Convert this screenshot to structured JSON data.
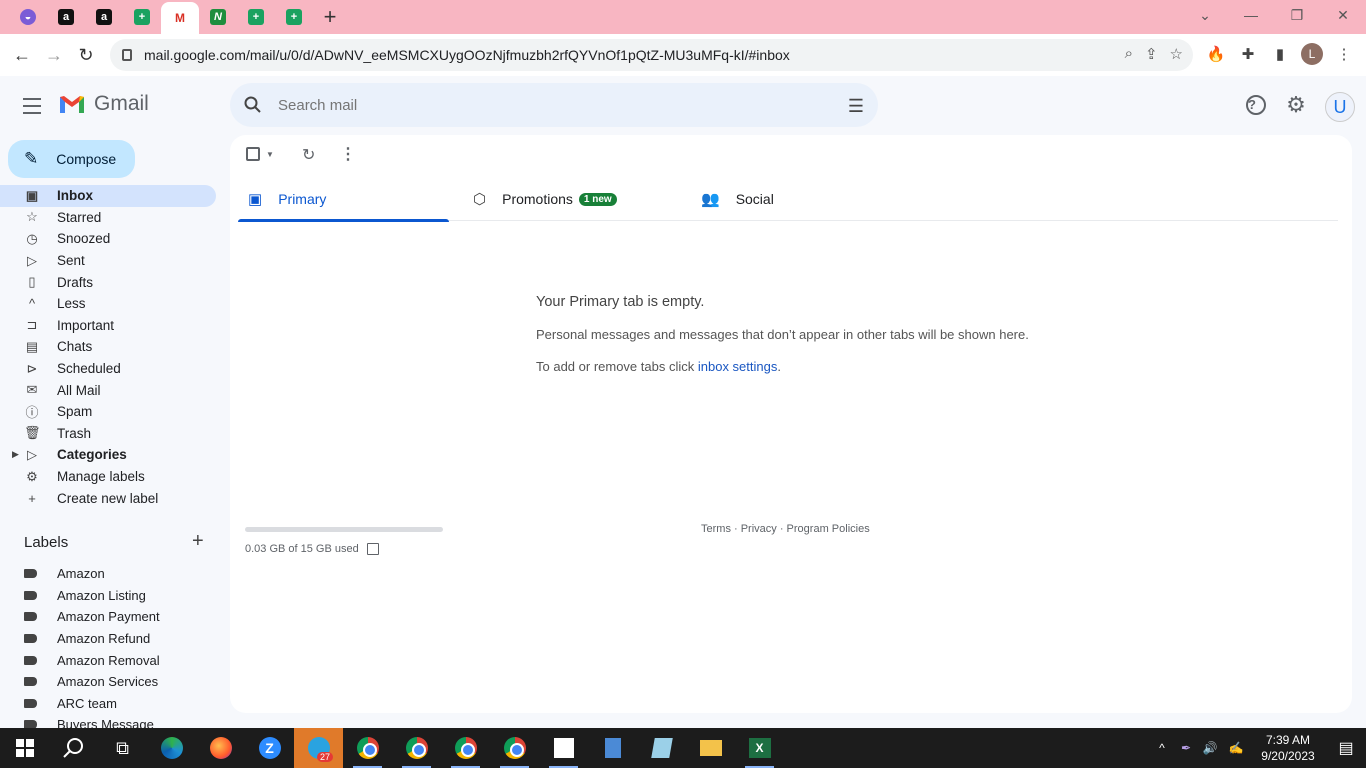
{
  "browser": {
    "tabs": [
      {
        "favicon": "chat-icon",
        "text": ""
      },
      {
        "favicon": "amazon-icon",
        "text": "a"
      },
      {
        "favicon": "amazon-icon",
        "text": "a"
      },
      {
        "favicon": "sheets-icon",
        "text": "+"
      },
      {
        "favicon": "gmail-icon",
        "text": "M"
      },
      {
        "favicon": "n-icon",
        "text": "N"
      },
      {
        "favicon": "sheets-icon",
        "text": "+"
      },
      {
        "favicon": "sheets-icon",
        "text": "+"
      }
    ],
    "new_tab": "+",
    "url": "mail.google.com/mail/u/0/d/ADwNV_eeMSMCXUygOOzNjfmuzbh2rfQYVnOf1pQtZ-MU3uMFq-kI/#inbox",
    "profile_initial": "L"
  },
  "gmail": {
    "app_name": "Gmail",
    "search_placeholder": "Search mail",
    "account_initial": "U",
    "compose_label": "Compose",
    "nav": [
      {
        "label": "Inbox",
        "icon": "inbox-icon",
        "active": true
      },
      {
        "label": "Starred",
        "icon": "star-icon"
      },
      {
        "label": "Snoozed",
        "icon": "clock-icon"
      },
      {
        "label": "Sent",
        "icon": "send-icon"
      },
      {
        "label": "Drafts",
        "icon": "draft-icon"
      },
      {
        "label": "Less",
        "icon": "chevron-up-icon"
      },
      {
        "label": "Important",
        "icon": "important-icon"
      },
      {
        "label": "Chats",
        "icon": "chat-icon"
      },
      {
        "label": "Scheduled",
        "icon": "scheduled-icon"
      },
      {
        "label": "All Mail",
        "icon": "all-mail-icon"
      },
      {
        "label": "Spam",
        "icon": "spam-icon"
      },
      {
        "label": "Trash",
        "icon": "trash-icon"
      },
      {
        "label": "Categories",
        "icon": "label-icon",
        "bold": true
      },
      {
        "label": "Manage labels",
        "icon": "gear-icon"
      },
      {
        "label": "Create new label",
        "icon": "plus-icon"
      }
    ],
    "labels_header": "Labels",
    "labels": [
      "Amazon",
      "Amazon Listing",
      "Amazon Payment",
      "Amazon Refund",
      "Amazon Removal",
      "Amazon Services",
      "ARC team",
      "Buyers Message"
    ],
    "tabs": [
      {
        "label": "Primary",
        "icon": "inbox-icon",
        "active": true
      },
      {
        "label": "Promotions",
        "icon": "tag-icon",
        "badge": "1 new"
      },
      {
        "label": "Social",
        "icon": "people-icon"
      }
    ],
    "empty": {
      "title": "Your Primary tab is empty.",
      "line1": "Personal messages and messages that don’t appear in other tabs will be shown here.",
      "line2_prefix": "To add or remove tabs click ",
      "line2_link": "inbox settings",
      "line2_suffix": "."
    },
    "storage": {
      "text": "0.03 GB of 15 GB used",
      "fraction": 0.002
    },
    "footer": "Terms · Privacy · Program Policies"
  },
  "taskbar": {
    "telegram_badge": "27",
    "time": "7:39 AM",
    "date": "9/20/2023"
  },
  "colors": {
    "tabbar": "#f8b6c2",
    "accent": "#0b57d0",
    "nav_active": "#d3e3fd",
    "compose": "#c2e7ff",
    "badge": "#188038"
  }
}
